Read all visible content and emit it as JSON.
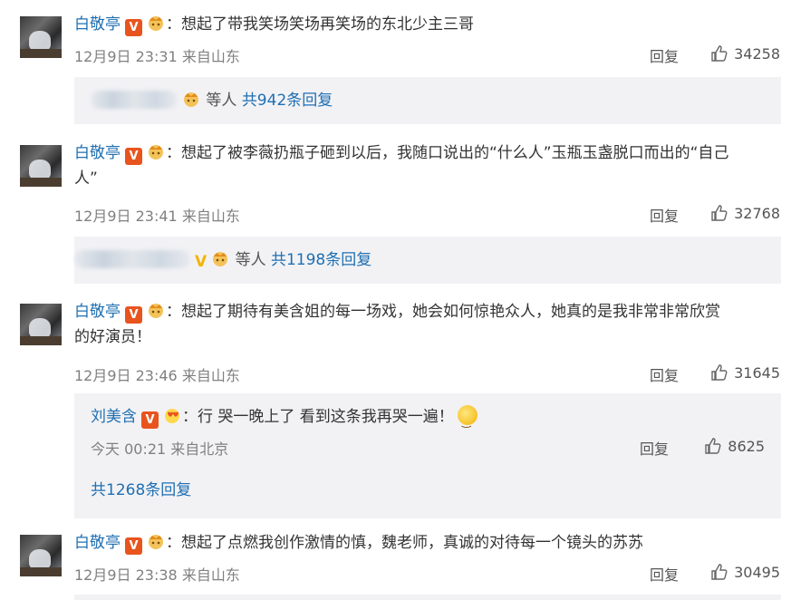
{
  "comments": [
    {
      "user": "白敬亭",
      "text_lines": [
        "：想起了带我笑场笑场再笑场的东北少主三哥"
      ],
      "time": "12月9日 23:31 来自山东",
      "reply_label": "回复",
      "likes": "34258",
      "summary": {
        "suffix": "等人",
        "count_text": "共942条回复"
      }
    },
    {
      "user": "白敬亭",
      "text_lines": [
        "：想起了被李薇扔瓶子砸到以后，我随口说出的“什么人”玉瓶玉盏脱口而出的“自己",
        "人”"
      ],
      "time": "12月9日 23:41 来自山东",
      "reply_label": "回复",
      "likes": "32768",
      "summary": {
        "suffix": "等人",
        "count_text": "共1198条回复"
      }
    },
    {
      "user": "白敬亭",
      "text_lines": [
        "：想起了期待有美含姐的每一场戏，她会如何惊艳众人，她真的是我非常非常欣赏",
        "的好演员！"
      ],
      "time": "12月9日 23:46 来自山东",
      "reply_label": "回复",
      "likes": "31645",
      "sub_reply": {
        "user": "刘美含",
        "text": "：行 哭一晚上了 看到这条我再哭一遍！",
        "time": "今天 00:21 来自北京",
        "reply_label": "回复",
        "likes": "8625",
        "count_text": "共1268条回复"
      }
    },
    {
      "user": "白敬亭",
      "text_lines": [
        "：想起了点燃我创作激情的慎，魏老师，真诚的对待每一个镜头的苏苏"
      ],
      "time": "12月9日 23:38 来自山东",
      "reply_label": "回复",
      "likes": "30495"
    }
  ],
  "icons": {
    "verified": "verified-v-icon",
    "crown": "crown-badge-icon",
    "thumb": "thumbs-up-icon",
    "emoji": "smile-emoji-icon"
  },
  "colors": {
    "username": "#1f6fb2",
    "verified_orange": "#e8541e",
    "verified_yellow": "#f4b400",
    "reply_box_bg": "#f2f2f5",
    "meta_gray": "#808080"
  }
}
